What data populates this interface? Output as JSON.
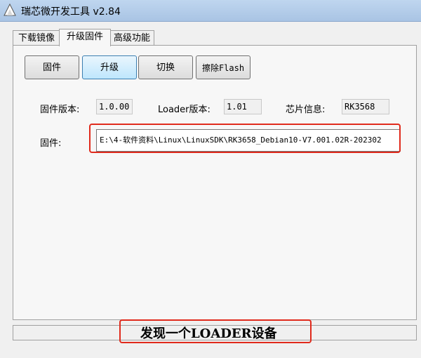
{
  "window": {
    "title": "瑞芯微开发工具 v2.84",
    "icon": "rockchip-app-icon"
  },
  "tabs": [
    {
      "label": "下载镜像",
      "active": false
    },
    {
      "label": "升级固件",
      "active": true
    },
    {
      "label": "高级功能",
      "active": false
    }
  ],
  "toolbar": {
    "firmware_label": "固件",
    "upgrade_label": "升级",
    "switch_label": "切换",
    "erase_flash_label": "擦除Flash"
  },
  "info": {
    "firmware_version_label": "固件版本:",
    "firmware_version_value": "1.0.00",
    "loader_version_label": "Loader版本:",
    "loader_version_value": "1.01",
    "chip_info_label": "芯片信息:",
    "chip_info_value": "RK3568"
  },
  "firmware_path": {
    "label": "固件:",
    "value": "E:\\4-软件资料\\Linux\\LinuxSDK\\RK3658_Debian10-V7.001.02R-202302"
  },
  "status": {
    "message": "发现一个LOADER设备"
  },
  "colors": {
    "highlight_box": "#e02a1c",
    "focused_button": "#bee6fd"
  }
}
